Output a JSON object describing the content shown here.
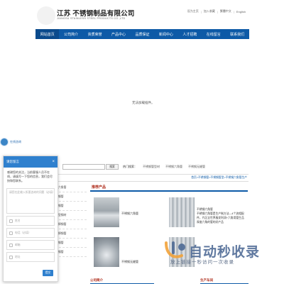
{
  "header": {
    "company_cn": "江苏    不锈钢制品有限公司",
    "company_en": "JIANGSU          STAINLESS STEEL PRODUCTS CO.,LTD",
    "top_links": [
      "设为主页",
      "加入收藏",
      "繁體中文",
      "English"
    ]
  },
  "nav": {
    "items": [
      "网站首页",
      "公司简介",
      "资质荣誉",
      "产品中心",
      "品质保证",
      "新闻中心",
      "人才招聘",
      "在线留言",
      "联系我们"
    ],
    "active_index": 0
  },
  "main": {
    "no_result": "无法加载插件。"
  },
  "consult_tab": {
    "label": "在线咨询"
  },
  "search": {
    "button_label": "搜索",
    "hot_label": "热门搜索：",
    "hot_items": [
      "不锈钢管型材",
      "不锈钢六角管",
      "不锈钢无缝管"
    ]
  },
  "breadcrumb": "首页>不锈钢管>不锈钢管型>不锈钢六角管生产",
  "categories": [
    "六角管",
    "钢管",
    "钢管",
    "型钢材",
    "焊钢管",
    "焊钢管",
    "钢管",
    "钢管"
  ],
  "recommended": {
    "title": "推荐产品",
    "products": [
      {
        "name": "不锈钢六角管"
      },
      {
        "name": "不锈钢六角管"
      },
      {
        "name": "不锈钢无缝管"
      }
    ],
    "product_desc": "不锈钢六角管是生产制方法—4个流相配件，片区全世界服发利润+六角用管生品厚度六角的管的好产品"
  },
  "footer_sections": {
    "company_intro": "公司简介",
    "production": "生产车间"
  },
  "chat": {
    "title": "请您留言",
    "close": "×",
    "greeting": "感谢您的关注，当前客服人员不在线，请填写一下您的信息，我们会尽快和您联系。",
    "message_placeholder": "请您在此输入所要咨询的问题（必填）",
    "name_placeholder": "姓名",
    "phone_placeholder": "电话（必填）",
    "email_placeholder": "邮箱",
    "address_placeholder": "地址",
    "submit": "提交"
  },
  "watermark": {
    "main": "自动秒收录",
    "sub": "放上链接一秒访问一次收录"
  },
  "colors": {
    "nav_blue": "#0d5aa7",
    "chat_blue": "#2f80ce",
    "accent_red": "#b0301f"
  }
}
